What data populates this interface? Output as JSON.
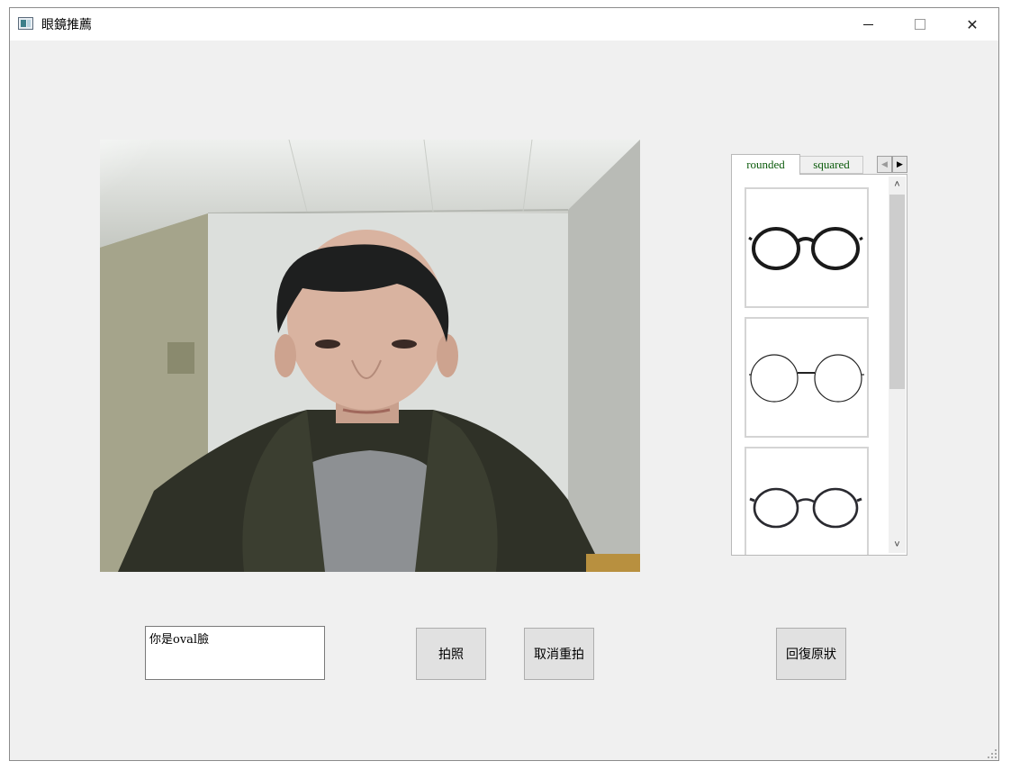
{
  "window": {
    "title": "眼鏡推薦",
    "controls": {
      "minimize": "minimize",
      "maximize": "maximize",
      "close": "✕"
    }
  },
  "camera": {
    "description_icon": "camera-feed"
  },
  "tabs": {
    "items": [
      {
        "label": "rounded",
        "selected": true
      },
      {
        "label": "squared",
        "selected": false
      }
    ],
    "scroll_left": "◀",
    "scroll_right": "▶"
  },
  "glasses_list": {
    "items": [
      {
        "icon": "round-thick-frame-glasses-icon"
      },
      {
        "icon": "round-thin-wire-glasses-icon"
      },
      {
        "icon": "round-medium-frame-glasses-icon"
      }
    ],
    "scroll_up": "˄",
    "scroll_down": "˅"
  },
  "result": {
    "text": "你是oval臉"
  },
  "buttons": {
    "capture": "拍照",
    "cancel_retake": "取消重拍",
    "restore": "回復原狀"
  },
  "colors": {
    "window_bg": "#f0f0f0",
    "tab_text": "#0a5a0a",
    "button_bg": "#e1e1e1"
  }
}
